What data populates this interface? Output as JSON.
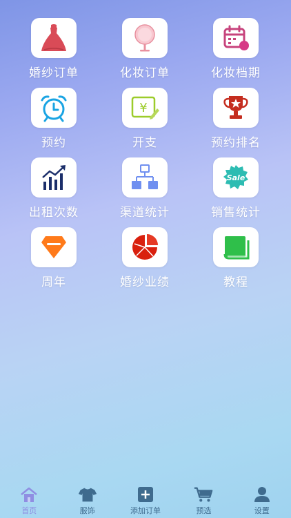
{
  "tiles": [
    {
      "label": "婚纱订单",
      "icon": "wedding-dress-icon"
    },
    {
      "label": "化妆订单",
      "icon": "mirror-icon"
    },
    {
      "label": "化妆档期",
      "icon": "calendar-icon"
    },
    {
      "label": "预约",
      "icon": "alarm-clock-icon"
    },
    {
      "label": "开支",
      "icon": "expense-note-icon"
    },
    {
      "label": "预约排名",
      "icon": "trophy-icon"
    },
    {
      "label": "出租次数",
      "icon": "bar-chart-icon"
    },
    {
      "label": "渠道统计",
      "icon": "flowchart-icon"
    },
    {
      "label": "销售统计",
      "icon": "sale-badge-icon"
    },
    {
      "label": "周年",
      "icon": "diamond-icon"
    },
    {
      "label": "婚纱业绩",
      "icon": "pie-chart-icon"
    },
    {
      "label": "教程",
      "icon": "book-icon"
    }
  ],
  "tabbar": {
    "items": [
      {
        "label": "首页",
        "icon": "home-icon",
        "active": true
      },
      {
        "label": "服饰",
        "icon": "shirt-icon",
        "active": false
      },
      {
        "label": "添加订单",
        "icon": "add-order-icon",
        "active": false
      },
      {
        "label": "预选",
        "icon": "cart-icon",
        "active": false
      },
      {
        "label": "设置",
        "icon": "user-icon",
        "active": false
      }
    ]
  },
  "colors": {
    "dress": "#d94b57",
    "mirror": "#f3a8b5",
    "calendar": "#c7437c",
    "clock": "#1aa4e3",
    "expense": "#9ccc2a",
    "trophy": "#c52d1f",
    "chart": "#1b2e6a",
    "flow": "#6f8ff0",
    "sale": "#2dbcb2",
    "diamond": "#ff7a1a",
    "pie": "#d9200e",
    "book": "#2fbf4a",
    "tab_active": "#8f8ee2",
    "tab_inactive": "#3f6b8e"
  }
}
